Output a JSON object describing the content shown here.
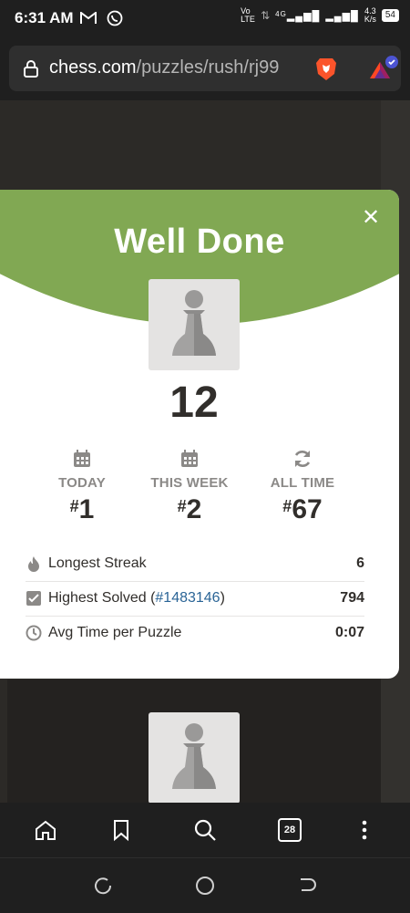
{
  "status_bar": {
    "time": "6:31 AM",
    "volte": "Vo LTE",
    "network": "4G",
    "speed_value": "4.3",
    "speed_unit": "K/s",
    "battery": "54"
  },
  "browser": {
    "url_domain": "chess.com",
    "url_path": "/puzzles/rush/rj99",
    "tab_count": "28"
  },
  "modal": {
    "title": "Well Done",
    "close_symbol": "✕",
    "score": "12",
    "stats": [
      {
        "label": "TODAY",
        "hash": "#",
        "rank": "1",
        "icon": "calendar-icon"
      },
      {
        "label": "THIS WEEK",
        "hash": "#",
        "rank": "2",
        "icon": "calendar-icon"
      },
      {
        "label": "ALL TIME",
        "hash": "#",
        "rank": "67",
        "icon": "refresh-icon"
      }
    ],
    "details": {
      "longest_streak_label": "Longest Streak",
      "longest_streak_value": "6",
      "highest_solved_label": "Highest Solved (",
      "highest_solved_link": "#1483146",
      "highest_solved_close": ")",
      "highest_solved_value": "794",
      "avg_time_label": "Avg Time per Puzzle",
      "avg_time_value": "0:07"
    }
  },
  "colors": {
    "header_green": "#81a853",
    "text_dark": "#312e2b",
    "muted": "#8b8987",
    "link": "#2a6496"
  }
}
